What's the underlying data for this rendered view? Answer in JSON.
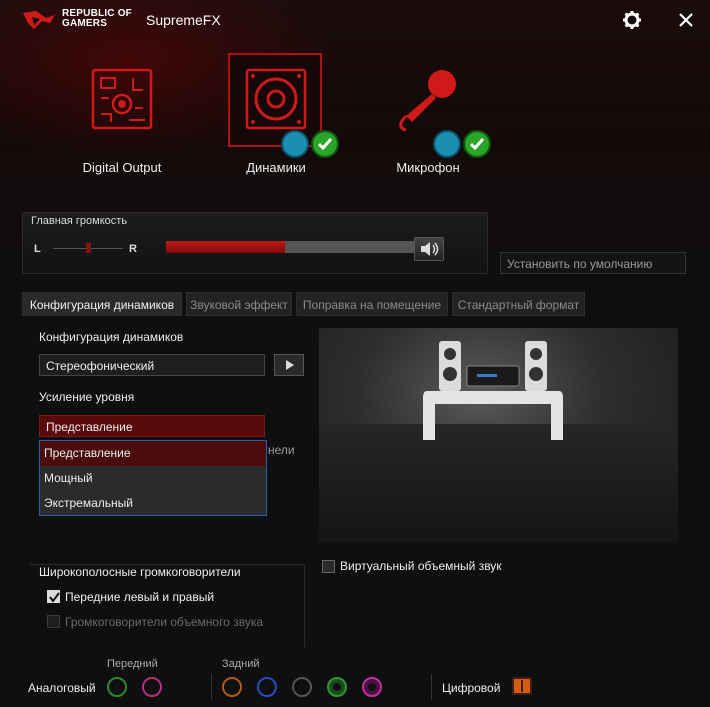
{
  "window": {
    "brand_line1": "REPUBLIC OF",
    "brand_line2": "GAMERS",
    "app_title": "SupremeFX",
    "settings_icon": "gear-icon",
    "close_icon": "close-icon"
  },
  "sources": [
    {
      "label": "Digital Output",
      "icon": "circuit-board-icon",
      "selected": false
    },
    {
      "label": "Динамики",
      "icon": "speaker-icon",
      "selected": true
    },
    {
      "label": "Микрофон",
      "icon": "microphone-icon",
      "selected": false
    }
  ],
  "master_volume": {
    "title": "Главная громкость",
    "left_label": "L",
    "right_label": "R",
    "balance": 0.5,
    "level_percent": 48,
    "mute_icon": "speaker-volume-icon"
  },
  "default_button": "Установить по умолчанию",
  "tabs": [
    {
      "label": "Конфигурация динамиков",
      "active": true
    },
    {
      "label": "Звуковой эффект",
      "active": false
    },
    {
      "label": "Поправка на помещение",
      "active": false
    },
    {
      "label": "Стандартный формат",
      "active": false
    }
  ],
  "speaker_config": {
    "label": "Конфигурация динамиков",
    "value": "Стереофонический",
    "play_icon": "play-icon"
  },
  "gain": {
    "label": "Усиление уровня",
    "value": "Представление",
    "options": [
      "Представление",
      "Мощный",
      "Экстремальный"
    ],
    "behind_text": "нели"
  },
  "virtual_surround": {
    "label": "Виртуальный объемный звук",
    "checked": false
  },
  "fullrange": {
    "title": "Широкополосные громкоговорители",
    "front": {
      "label": "Передние левый и правый",
      "checked": true
    },
    "surround": {
      "label": "Громкоговорители объемного звука",
      "checked": false,
      "disabled": true
    }
  },
  "jacks": {
    "analog_label": "Аналоговый",
    "front_label": "Передний",
    "rear_label": "Задний",
    "digital_label": "Цифровой",
    "front_colors": [
      "#2a8a2a",
      "#b0307a"
    ],
    "rear_colors": [
      "#b05a20",
      "#2050c0",
      "#555555",
      "#2a9a2a",
      "#c030a0"
    ]
  },
  "colors": {
    "accent": "#b01010"
  }
}
